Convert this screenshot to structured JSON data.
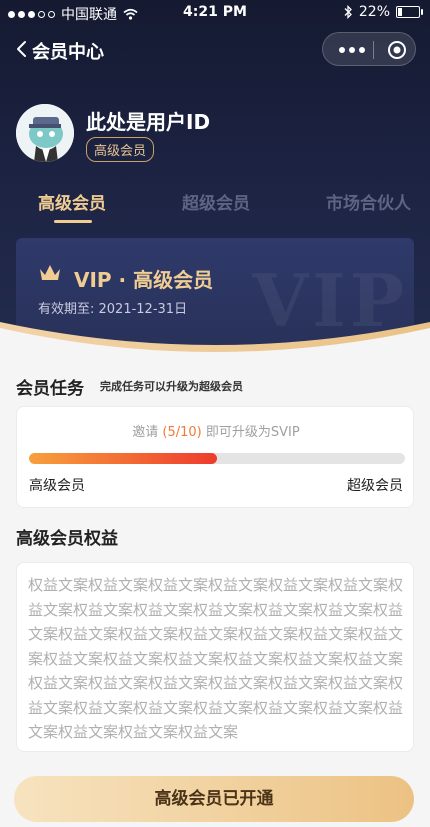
{
  "status_bar": {
    "carrier": "中国联通",
    "time": "4:21 PM",
    "battery": "22%",
    "battery_level": 0.22
  },
  "nav": {
    "title": "会员中心"
  },
  "profile": {
    "user_id": "此处是用户ID",
    "level": "高级会员"
  },
  "tabs": [
    {
      "label": "高级会员",
      "active": true
    },
    {
      "label": "超级会员",
      "active": false
    },
    {
      "label": "市场合伙人",
      "active": false
    }
  ],
  "vip_card": {
    "title": "VIP · 高级会员",
    "expiry_label": "有效期至: ",
    "expiry_date": "2021-12-31日",
    "watermark": "VIP"
  },
  "tasks": {
    "title": "会员任务",
    "hint": "完成任务可以升级为超级会员",
    "invite_prefix": "邀请 ",
    "invite_count": "(5/10)",
    "invite_suffix": " 即可升级为SVIP",
    "progress": 0.5,
    "from_level": "高级会员",
    "to_level": "超级会员"
  },
  "benefits": {
    "title": "高级会员权益",
    "text": "权益文案权益文案权益文案权益文案权益文案权益文案权益文案权益文案权益文案权益文案权益文案权益文案权益文案权益文案权益文案权益文案权益文案权益文案权益文案权益文案权益文案权益文案权益文案权益文案权益文案权益文案权益文案权益文案权益文案权益文案权益文案权益文案权益文案权益文案权益文案权益文案权益文案权益文案权益文案权益文案权益文案"
  },
  "cta": {
    "label": "高级会员已开通"
  },
  "colors": {
    "gold": "#f0cd93",
    "header_bg": "#1d2444",
    "accent_orange": "#f07a3a"
  }
}
